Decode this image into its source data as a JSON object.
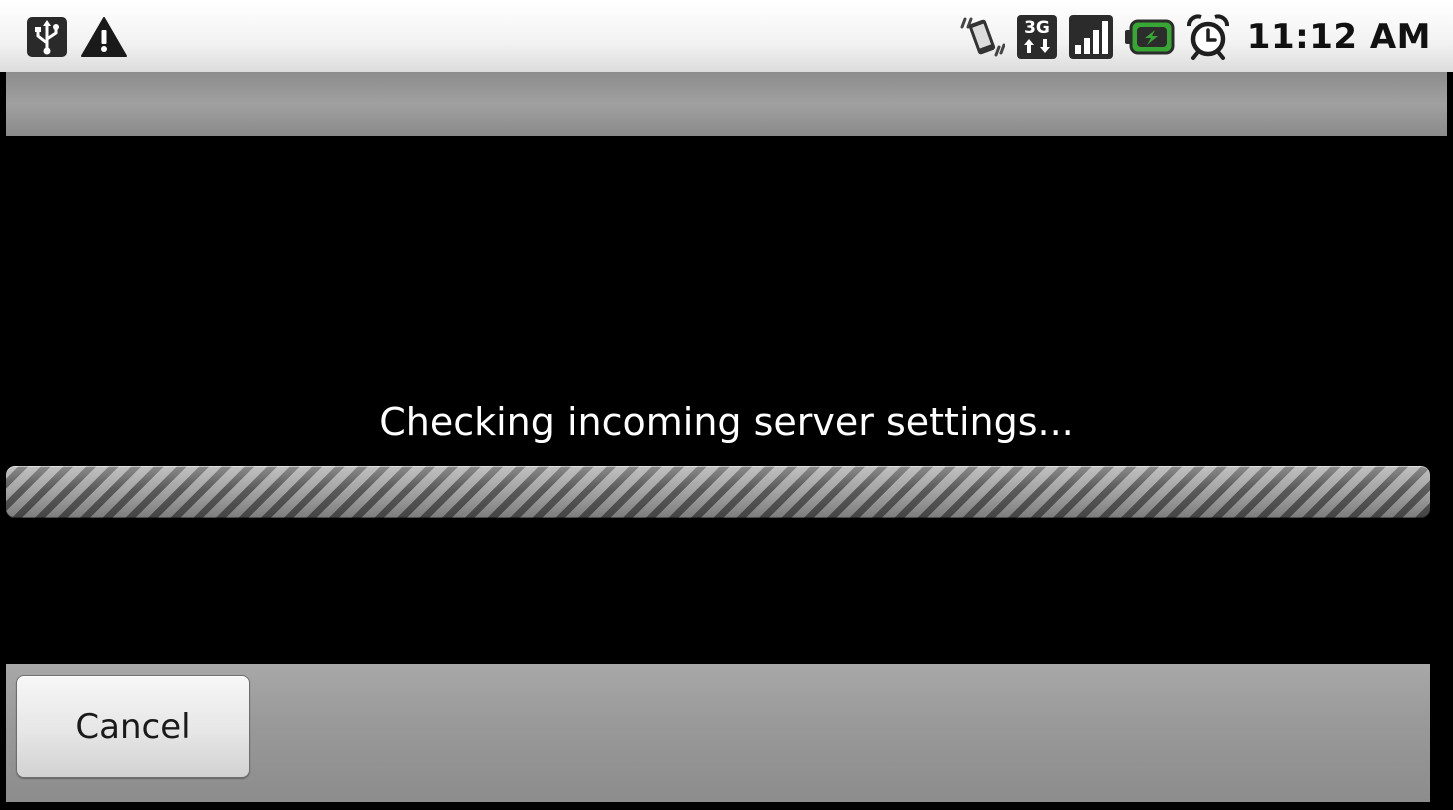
{
  "status_bar": {
    "left_icons": [
      "usb-icon",
      "warning-icon"
    ],
    "right_icons": [
      "vibrate-icon",
      "3g-data-icon",
      "signal-strength-icon",
      "battery-charging-icon",
      "alarm-clock-icon"
    ],
    "data_indicator_text": "3G",
    "time": "11:12 AM",
    "battery_color": "#39a535"
  },
  "progress": {
    "message": "Checking incoming server settings...",
    "indeterminate": true
  },
  "button_bar": {
    "cancel_label": "Cancel"
  }
}
